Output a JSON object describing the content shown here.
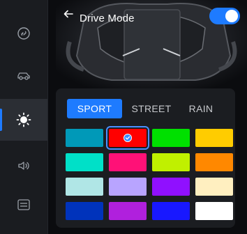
{
  "header": {
    "title": "Drive Mode",
    "toggle_on": true
  },
  "sidebar": {
    "items": [
      {
        "icon": "link-icon",
        "active": false
      },
      {
        "icon": "car-icon",
        "active": false
      },
      {
        "icon": "sun-icon",
        "active": true
      },
      {
        "icon": "speaker-icon",
        "active": false
      },
      {
        "icon": "settings-panel-icon",
        "active": false
      }
    ]
  },
  "mode_tabs": [
    {
      "label": "SPORT",
      "selected": true
    },
    {
      "label": "STREET",
      "selected": false
    },
    {
      "label": "RAIN",
      "selected": false
    }
  ],
  "colors": {
    "accent": "#1e7bff",
    "swatches": [
      [
        "#0099b8",
        "#ff0000",
        "#00e000",
        "#ffcc00"
      ],
      [
        "#00e0c8",
        "#ff1177",
        "#c0f000",
        "#ff8800"
      ],
      [
        "#b0e6e6",
        "#b8a4ff",
        "#9010ff",
        "#ffefc0"
      ],
      [
        "#0033bb",
        "#b020dd",
        "#1818ff",
        "#ffffff"
      ]
    ],
    "selected_swatch": "row0-col1"
  }
}
